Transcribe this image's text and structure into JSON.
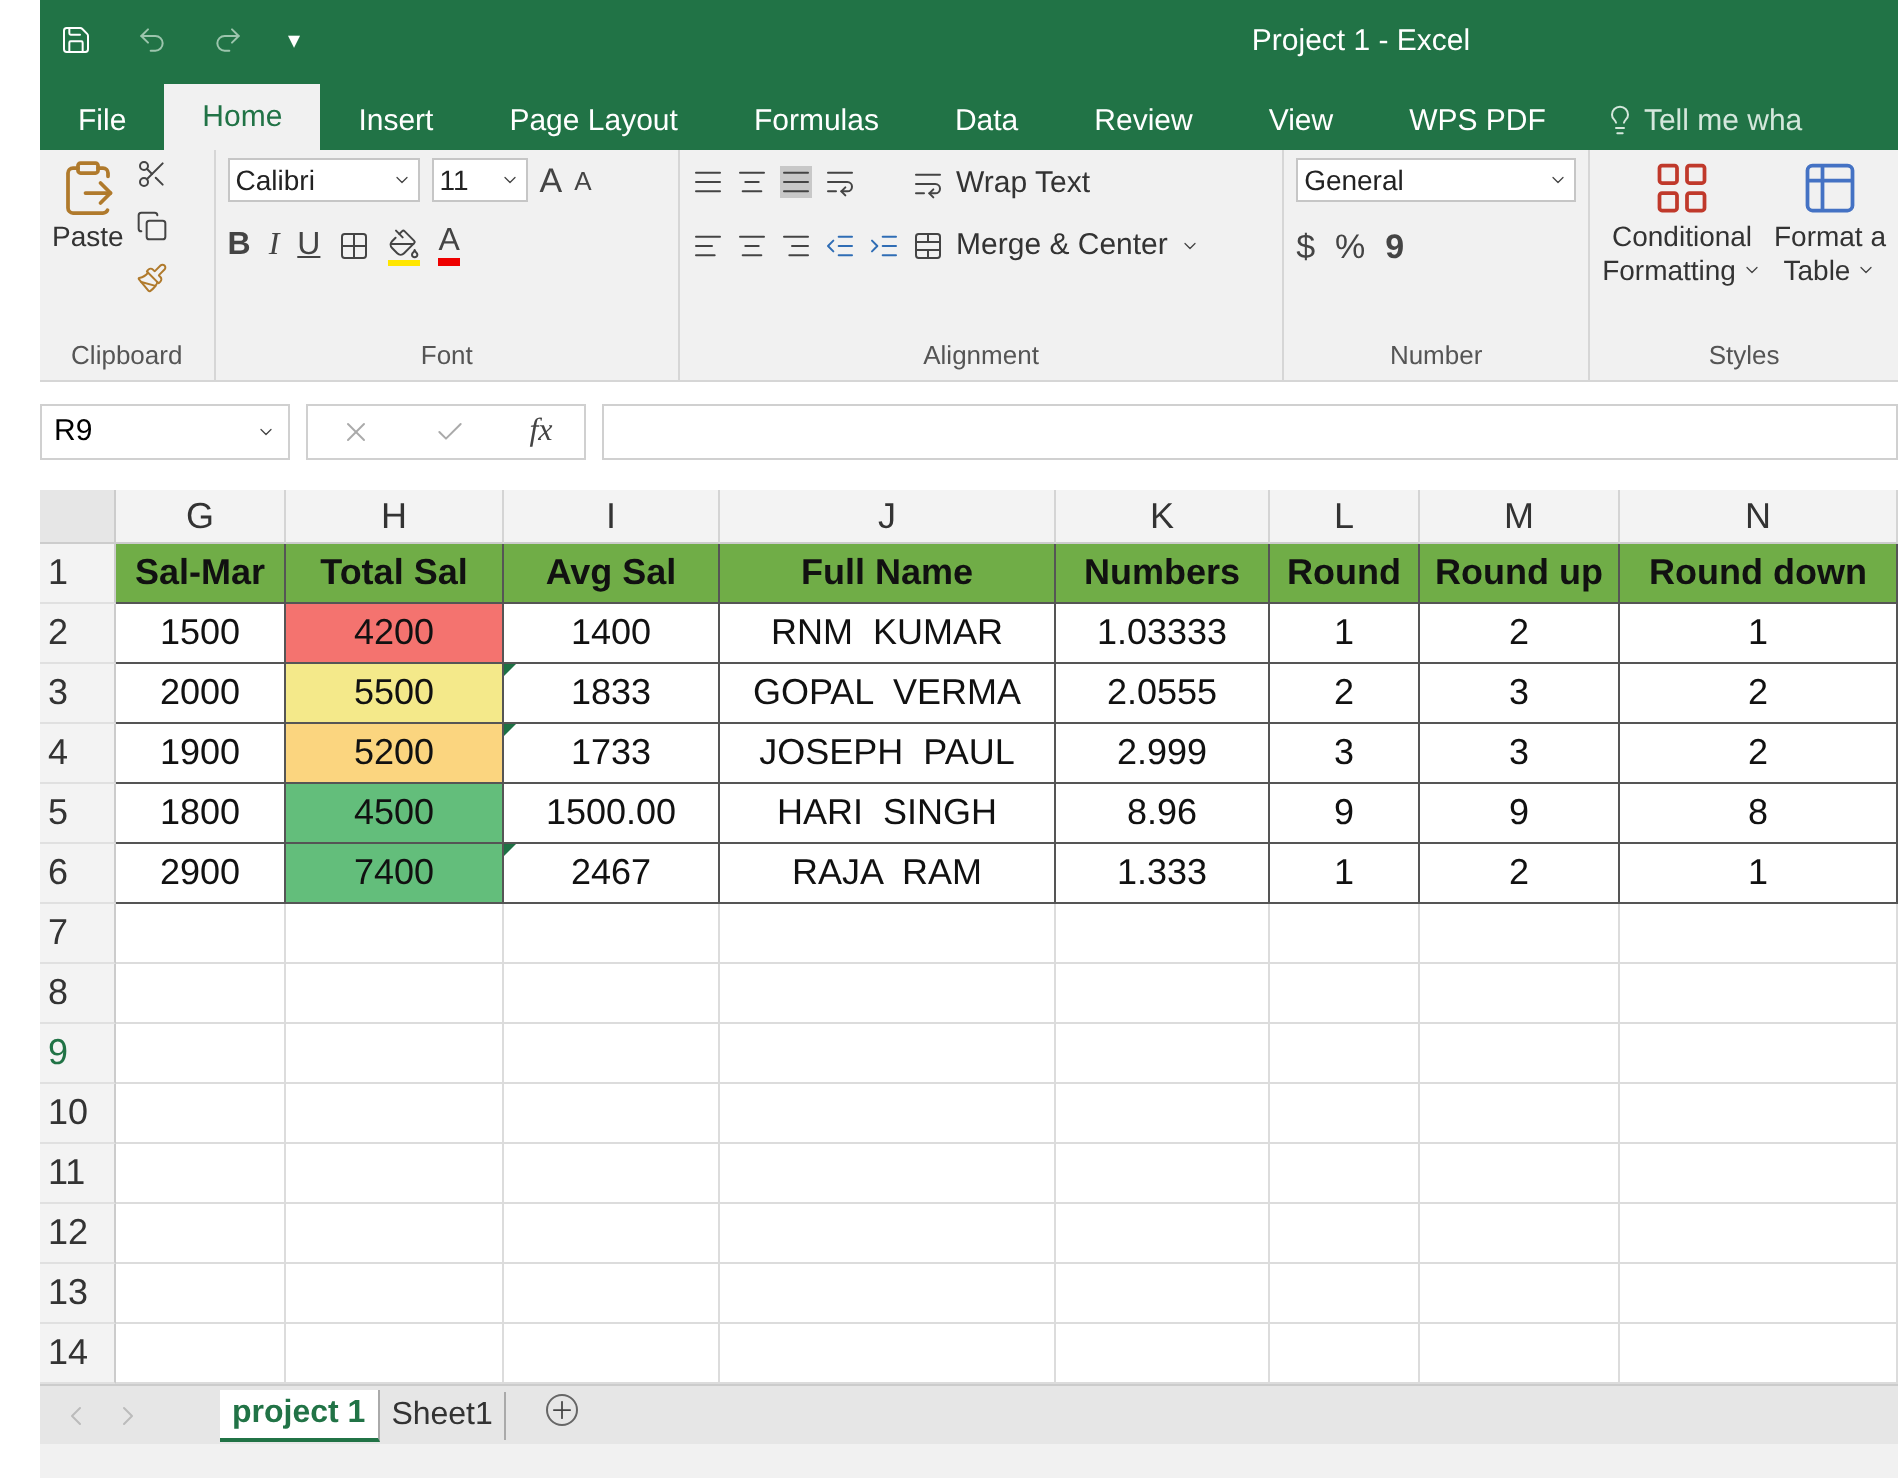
{
  "window": {
    "title": "Project 1 - Excel"
  },
  "quick_access": {
    "customize": "▾"
  },
  "ribbon_tabs": [
    {
      "label": "File",
      "selected": false
    },
    {
      "label": "Home",
      "selected": true
    },
    {
      "label": "Insert",
      "selected": false
    },
    {
      "label": "Page Layout",
      "selected": false
    },
    {
      "label": "Formulas",
      "selected": false
    },
    {
      "label": "Data",
      "selected": false
    },
    {
      "label": "Review",
      "selected": false
    },
    {
      "label": "View",
      "selected": false
    },
    {
      "label": "WPS PDF",
      "selected": false
    }
  ],
  "tell_me": {
    "placeholder": "Tell me wha"
  },
  "ribbon": {
    "clipboard": {
      "paste": "Paste",
      "label": "Clipboard"
    },
    "font": {
      "name": "Calibri",
      "size": "11",
      "grow": "A",
      "shrink": "A",
      "styles": [
        "B",
        "I",
        "U"
      ],
      "color_letter": "A",
      "label": "Font"
    },
    "alignment": {
      "wrap": "Wrap Text",
      "merge": "Merge & Center",
      "label": "Alignment"
    },
    "number": {
      "format": "General",
      "symbols": [
        "$",
        "%",
        "9"
      ],
      "label": "Number"
    },
    "styles": {
      "buttons": [
        {
          "top": "Conditional",
          "bottom": "Formatting"
        },
        {
          "top": "Format a",
          "bottom": "Table"
        }
      ],
      "label": "Styles"
    }
  },
  "formula_bar": {
    "name_box": "R9",
    "function_label": "fx"
  },
  "sheet": {
    "columns": [
      "G",
      "H",
      "I",
      "J",
      "K",
      "L",
      "M",
      "N"
    ],
    "header_row": {
      "number": "1",
      "selected": false,
      "cells": [
        "Sal-Mar",
        "Total Sal",
        "Avg Sal",
        "Full Name",
        "Numbers",
        "Round",
        "Round up",
        "Round down"
      ]
    },
    "rows": [
      {
        "number": "2",
        "selected": false,
        "cells": [
          "1500",
          "4200",
          "1400",
          "RNM  KUMAR",
          "1.03333",
          "1",
          "2",
          "1"
        ],
        "color": "#f4736f",
        "avg_flagged": false
      },
      {
        "number": "3",
        "selected": false,
        "cells": [
          "2000",
          "5500",
          "1833",
          "GOPAL  VERMA",
          "2.0555",
          "2",
          "3",
          "2"
        ],
        "color": "#f4e98a",
        "avg_flagged": true
      },
      {
        "number": "4",
        "selected": false,
        "cells": [
          "1900",
          "5200",
          "1733",
          "JOSEPH  PAUL",
          "2.999",
          "3",
          "3",
          "2"
        ],
        "color": "#fbd57f",
        "avg_flagged": true
      },
      {
        "number": "5",
        "selected": false,
        "cells": [
          "1800",
          "4500",
          "1500.00",
          "HARI  SINGH",
          "8.96",
          "9",
          "9",
          "8"
        ],
        "color": "#63be7b",
        "avg_flagged": false
      },
      {
        "number": "6",
        "selected": false,
        "cells": [
          "2900",
          "7400",
          "2467",
          "RAJA  RAM",
          "1.333",
          "1",
          "2",
          "1"
        ],
        "color": "#63be7b",
        "avg_flagged": true
      },
      {
        "number": "7",
        "selected": false
      },
      {
        "number": "8",
        "selected": false
      },
      {
        "number": "9",
        "selected": true
      },
      {
        "number": "10",
        "selected": false
      },
      {
        "number": "11",
        "selected": false
      },
      {
        "number": "12",
        "selected": false
      },
      {
        "number": "13",
        "selected": false
      },
      {
        "number": "14",
        "selected": false
      }
    ]
  },
  "sheet_tabs": [
    {
      "label": "project 1",
      "selected": true
    },
    {
      "label": "Sheet1",
      "selected": false
    }
  ]
}
